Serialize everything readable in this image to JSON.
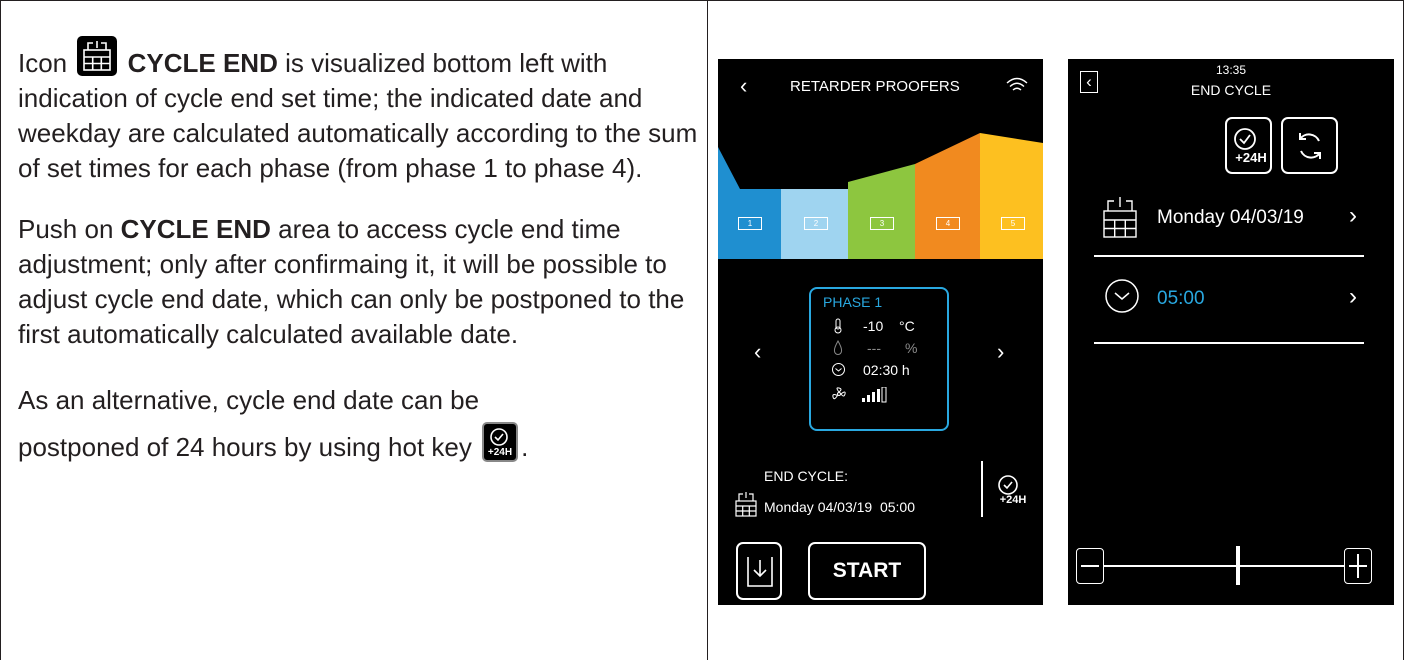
{
  "manual": {
    "p1_word_icon": "Icon",
    "p1_bold": "CYCLE END",
    "p1_rest": "is visualized bottom left with indication of cycle end set time; the indicated date and weekday are calculated automatically according to the sum of set times for each phase (from phase 1 to phase 4).",
    "p2_push": "Push on",
    "p2_bold": "CYCLE END",
    "p2_rest": "area to access cycle end time adjustment; only after confirmaing it, it will be possible to adjust cycle end date, which can only be postponed to the first automatically calculated available date.",
    "p3_a": "As an alternative, cycle end date can be",
    "p3_b": "postponed of 24 hours by using hot key",
    "p3_end": "."
  },
  "screen1": {
    "title": "RETARDER PROOFERS",
    "phase_numbers": [
      "1",
      "2",
      "3",
      "4",
      "5"
    ],
    "phase_colors": [
      "#1f8fd0",
      "#9fd4f0",
      "#8dc63f",
      "#f18a1f",
      "#fdc020"
    ],
    "phase_card": {
      "name": "PHASE 1",
      "temp_value": "-10",
      "temp_unit": "°C",
      "humidity_value": "---",
      "humidity_unit": "%",
      "time_value": "02:30 h"
    },
    "end_cycle_label": "END CYCLE:",
    "end_cycle_value": "Monday 04/03/19  05:00",
    "plus24_label": "+24H",
    "start_label": "START"
  },
  "screen2": {
    "clock": "13:35",
    "title": "END CYCLE",
    "plus24_label": "+24H",
    "date_value": "Monday 04/03/19",
    "time_value": "05:00",
    "slider_value": 0.56
  }
}
